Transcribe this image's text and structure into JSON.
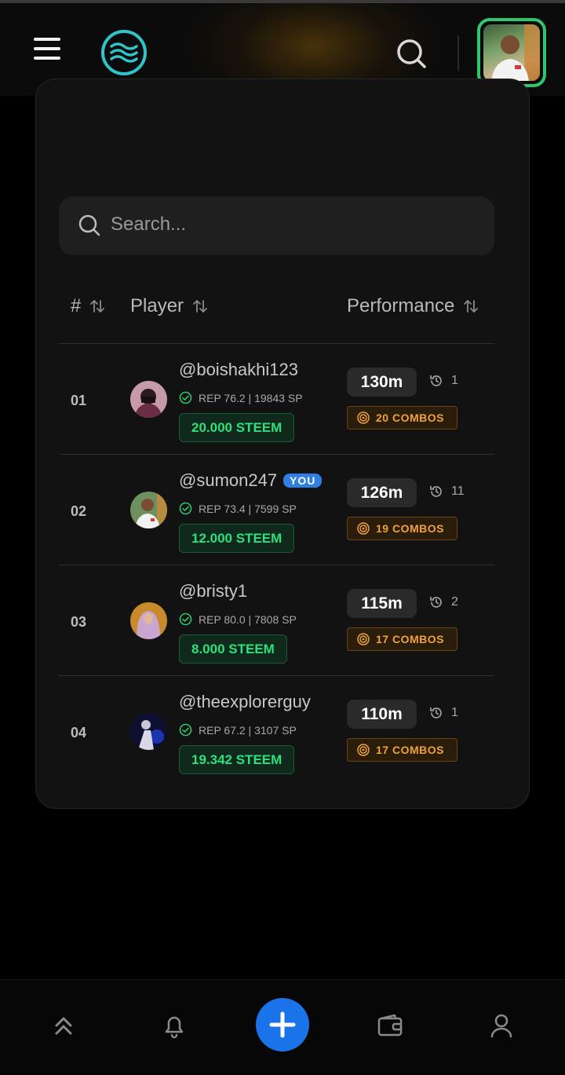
{
  "header": {
    "menu_icon": "hamburger-menu-icon",
    "logo_icon": "waves-logo-icon",
    "search_icon": "search-icon",
    "avatar_alt": "user-avatar"
  },
  "search": {
    "placeholder": "Search..."
  },
  "table": {
    "headers": {
      "rank": "#",
      "player": "Player",
      "performance": "Performance"
    },
    "rows": [
      {
        "rank": "01",
        "username": "@boishakhi123",
        "you": false,
        "rep": "REP 76.2 | 19843 SP",
        "steem": "20.000 STEEM",
        "time": "130m",
        "history": "1",
        "combos": "20 COMBOS"
      },
      {
        "rank": "02",
        "username": "@sumon247",
        "you": true,
        "you_label": "YOU",
        "rep": "REP 73.4 | 7599 SP",
        "steem": "12.000 STEEM",
        "time": "126m",
        "history": "11",
        "combos": "19 COMBOS"
      },
      {
        "rank": "03",
        "username": "@bristy1",
        "you": false,
        "rep": "REP 80.0 | 7808 SP",
        "steem": "8.000 STEEM",
        "time": "115m",
        "history": "2",
        "combos": "17 COMBOS"
      },
      {
        "rank": "04",
        "username": "@theexplorerguy",
        "you": false,
        "rep": "REP 67.2 | 3107 SP",
        "steem": "19.342 STEEM",
        "time": "110m",
        "history": "1",
        "combos": "17 COMBOS"
      }
    ]
  },
  "bottom_nav": {
    "items": [
      "double-chevron-up-icon",
      "bell-icon",
      "plus-icon",
      "wallet-icon",
      "user-icon"
    ]
  },
  "colors": {
    "accent_green": "#2ee07a",
    "accent_orange": "#f0a23a",
    "accent_blue": "#1a73e8",
    "logo_teal": "#2ec4c9"
  }
}
